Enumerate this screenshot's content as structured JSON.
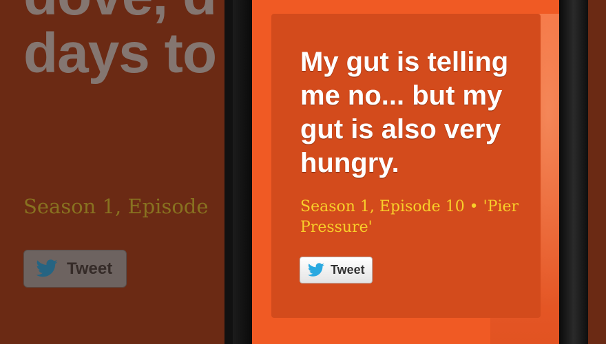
{
  "background_panel": {
    "quote_text": "dove, d Becaus days to",
    "episode_text": "Season 1, Episode",
    "tweet_label": "Tweet"
  },
  "screen": {
    "quote_text": "My gut is telling me no... but my gut is also very hungry.",
    "episode_text": "Season 1, Episode 10 • 'Pier Pressure'",
    "tweet_label": "Tweet",
    "twitter_icon": "twitter-bird-icon"
  },
  "colors": {
    "screen_bg": "#f05a24",
    "card_bg": "#d34b1c",
    "quote_text": "#ffffff",
    "episode_text": "#f8cf2a",
    "twitter_blue": "#2aa9e0"
  }
}
